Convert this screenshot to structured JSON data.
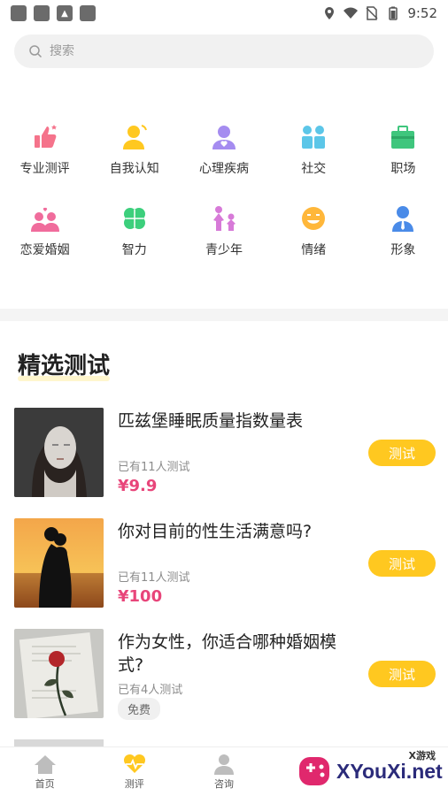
{
  "status_bar": {
    "time": "9:52"
  },
  "search": {
    "placeholder": "搜索"
  },
  "categories": [
    {
      "label": "专业测评",
      "icon": "thumbs-up-icon"
    },
    {
      "label": "自我认知",
      "icon": "person-icon"
    },
    {
      "label": "心理疾病",
      "icon": "person-heart-icon"
    },
    {
      "label": "社交",
      "icon": "people-icon"
    },
    {
      "label": "职场",
      "icon": "briefcase-icon"
    },
    {
      "label": "恋爱婚姻",
      "icon": "couple-icon"
    },
    {
      "label": "智力",
      "icon": "clover-icon"
    },
    {
      "label": "青少年",
      "icon": "family-icon"
    },
    {
      "label": "情绪",
      "icon": "smile-icon"
    },
    {
      "label": "形象",
      "icon": "businessman-icon"
    }
  ],
  "section": {
    "title": "精选测试"
  },
  "items": [
    {
      "title": "匹兹堡睡眠质量指数量表",
      "count": "已有11人测试",
      "price": "¥9.9",
      "button": "测试"
    },
    {
      "title": "你对目前的性生活满意吗?",
      "count": "已有11人测试",
      "price": "¥100",
      "button": "测试"
    },
    {
      "title": "作为女性，你适合哪种婚姻模式?",
      "count": "已有4人测试",
      "free": "免费",
      "button": "测试"
    }
  ],
  "bottom_nav": [
    {
      "label": "首页",
      "icon": "home-icon"
    },
    {
      "label": "测评",
      "icon": "heartbeat-icon"
    },
    {
      "label": "咨询",
      "icon": "consultant-icon"
    }
  ],
  "watermark": {
    "brand": "XYouXi.net",
    "small": "X游戏"
  },
  "colors": {
    "accent": "#ffc820",
    "price": "#e8457a"
  }
}
